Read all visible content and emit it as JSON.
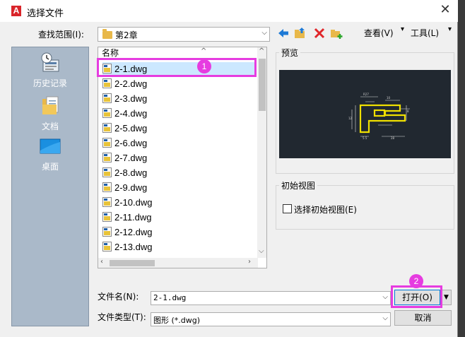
{
  "window": {
    "title": "选择文件",
    "close_label": "✕"
  },
  "toolbar": {
    "lookin_label": "查找范围(I):",
    "lookin_value": "第2章",
    "views_label": "查看(V)",
    "tools_label": "工具(L)",
    "back_icon": "back-arrow-icon",
    "up_icon": "up-folder-icon",
    "delete_icon": "delete-x-icon",
    "newfolder_icon": "new-folder-icon"
  },
  "places": [
    {
      "label": "历史记录",
      "icon": "history-icon"
    },
    {
      "label": "文档",
      "icon": "documents-icon"
    },
    {
      "label": "桌面",
      "icon": "desktop-icon"
    }
  ],
  "filelist": {
    "column_name": "名称",
    "files": [
      "2-1.dwg",
      "2-2.dwg",
      "2-3.dwg",
      "2-4.dwg",
      "2-5.dwg",
      "2-6.dwg",
      "2-7.dwg",
      "2-8.dwg",
      "2-9.dwg",
      "2-10.dwg",
      "2-11.dwg",
      "2-12.dwg",
      "2-13.dwg"
    ],
    "selected": "2-1.dwg"
  },
  "preview": {
    "label": "预览"
  },
  "initial_view": {
    "group_label": "初始视图",
    "checkbox_label": "选择初始视图(E)",
    "checked": false
  },
  "bottom": {
    "filename_label": "文件名(N):",
    "filename_value": "2-1.dwg",
    "filetype_label": "文件类型(T):",
    "filetype_value": "图形 (*.dwg)",
    "open_label": "打开(O)",
    "cancel_label": "取消"
  },
  "annotations": {
    "badge1": "1",
    "badge2": "2",
    "highlight_color": "#e63ce0"
  },
  "colors": {
    "selection": "#cce8ff",
    "places_bg": "#aab9c9",
    "preview_bg": "#212830",
    "drawing_yellow": "#f0e000"
  }
}
